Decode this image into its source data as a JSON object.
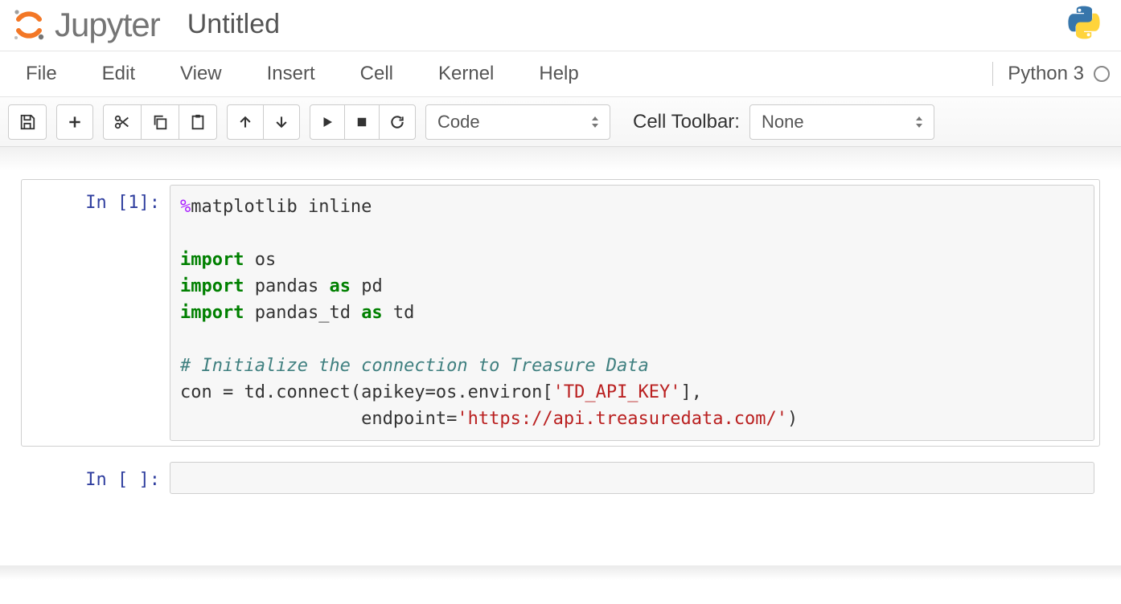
{
  "header": {
    "brand_text": "Jupyter",
    "notebook_title": "Untitled",
    "kernel_name": "Python 3"
  },
  "menu": {
    "file": "File",
    "edit": "Edit",
    "view": "View",
    "insert": "Insert",
    "cell": "Cell",
    "kernel": "Kernel",
    "help": "Help"
  },
  "toolbar": {
    "cell_type_selected": "Code",
    "cell_toolbar_label": "Cell Toolbar:",
    "cell_toolbar_selected": "None"
  },
  "cells": [
    {
      "prompt": "In [1]:",
      "tokens": [
        {
          "t": "%",
          "c": "cm-magic"
        },
        {
          "t": "matplotlib inline\n\n",
          "c": ""
        },
        {
          "t": "import",
          "c": "cm-keyword"
        },
        {
          "t": " os\n",
          "c": ""
        },
        {
          "t": "import",
          "c": "cm-keyword"
        },
        {
          "t": " pandas ",
          "c": ""
        },
        {
          "t": "as",
          "c": "cm-keyword"
        },
        {
          "t": " pd\n",
          "c": ""
        },
        {
          "t": "import",
          "c": "cm-keyword"
        },
        {
          "t": " pandas_td ",
          "c": ""
        },
        {
          "t": "as",
          "c": "cm-keyword"
        },
        {
          "t": " td\n\n",
          "c": ""
        },
        {
          "t": "# Initialize the connection to Treasure Data\n",
          "c": "cm-comment"
        },
        {
          "t": "con = td.connect(apikey=os.environ[",
          "c": ""
        },
        {
          "t": "'TD_API_KEY'",
          "c": "cm-string"
        },
        {
          "t": "],\n",
          "c": ""
        },
        {
          "t": "                 endpoint=",
          "c": ""
        },
        {
          "t": "'https://api.treasuredata.com/'",
          "c": "cm-string"
        },
        {
          "t": ")",
          "c": ""
        }
      ]
    },
    {
      "prompt": "In [ ]:",
      "tokens": []
    }
  ]
}
